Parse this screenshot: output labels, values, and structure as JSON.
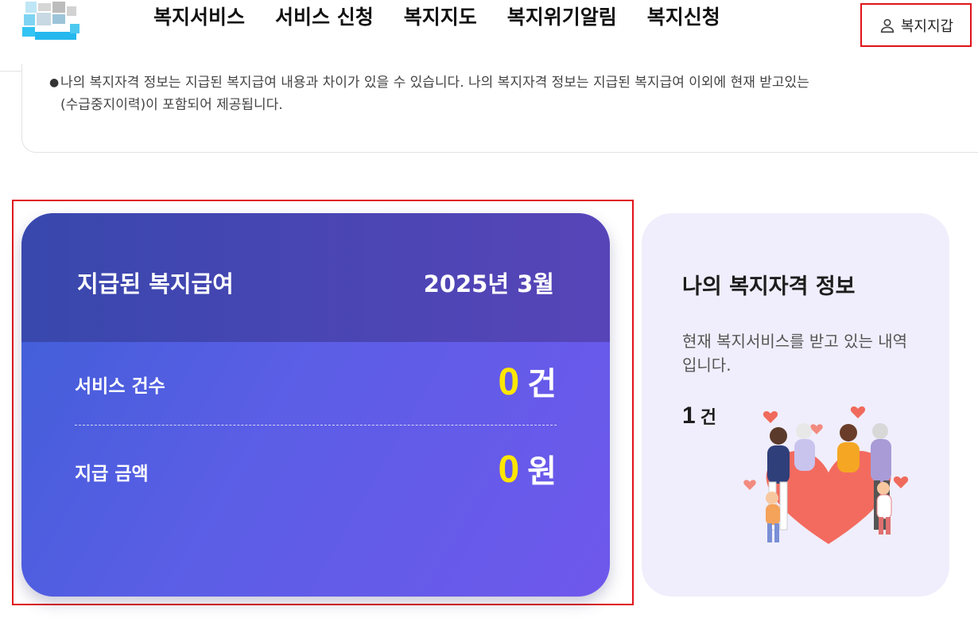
{
  "header": {
    "nav": [
      "복지서비스",
      "서비스 신청",
      "복지지도",
      "복지위기알림",
      "복지신청"
    ],
    "wallet_label": "복지지갑"
  },
  "notice": {
    "lines": [
      "나의 복지자격 정보는 지급된 복지급여 내용과 차이가 있을 수 있습니다. 나의 복지자격 정보는 지급된 복지급여 이외에 현재 받고있는",
      "(수급중지이력)이 포함되어 제공됩니다."
    ]
  },
  "benefit_card": {
    "title": "지급된 복지급여",
    "date": "2025년  3월",
    "rows": [
      {
        "label": "서비스 건수",
        "value": "0",
        "unit": "건"
      },
      {
        "label": "지급 금액",
        "value": "0",
        "unit": "원"
      }
    ]
  },
  "eligibility_card": {
    "title": "나의 복지자격 정보",
    "description": "현재 복지서비스를 받고 있는 내역입니다.",
    "count": "1",
    "unit": "건"
  },
  "colors": {
    "highlight": "#e0131b",
    "value_yellow": "#ffe600",
    "card_gradient_start": "#3e5fd6",
    "card_gradient_end": "#6f58ec",
    "lavender": "#f0eefc"
  }
}
